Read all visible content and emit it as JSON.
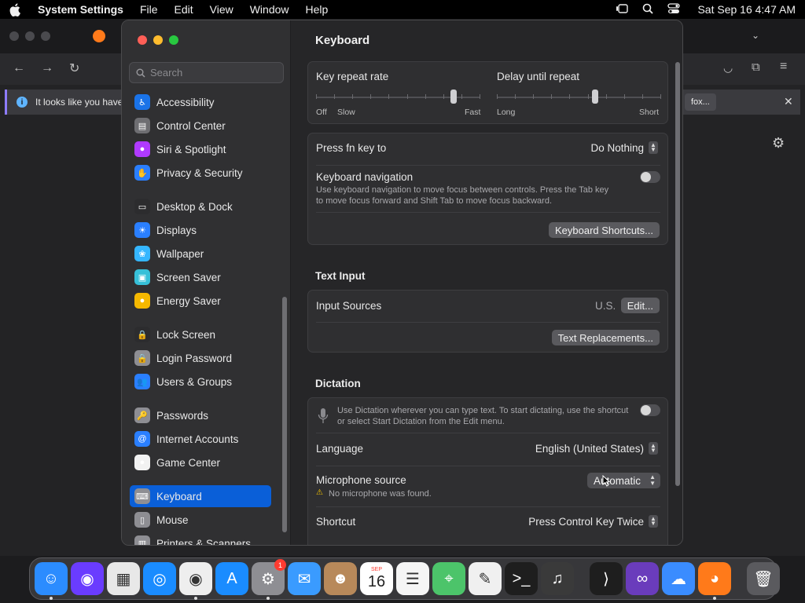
{
  "menubar": {
    "app_name": "System Settings",
    "items": [
      "File",
      "Edit",
      "View",
      "Window",
      "Help"
    ],
    "clock": "Sat Sep 16  4:47 AM"
  },
  "browser": {
    "notice_text": "It looks like you have",
    "notice_tail": "fox..."
  },
  "sidebar": {
    "search_placeholder": "Search",
    "items": [
      {
        "label": "Accessibility",
        "color": "#1a73e8",
        "glyph": "♿"
      },
      {
        "label": "Control Center",
        "color": "#6e6e72",
        "glyph": "▤"
      },
      {
        "label": "Siri & Spotlight",
        "color": "#b03aff",
        "glyph": "●"
      },
      {
        "label": "Privacy & Security",
        "color": "#2a7fff",
        "glyph": "✋"
      },
      {
        "label": "Desktop & Dock",
        "color": "#2c2c2e",
        "glyph": "▭"
      },
      {
        "label": "Displays",
        "color": "#2a7fff",
        "glyph": "☀"
      },
      {
        "label": "Wallpaper",
        "color": "#35b6ff",
        "glyph": "❀"
      },
      {
        "label": "Screen Saver",
        "color": "#37c0d8",
        "glyph": "▣"
      },
      {
        "label": "Energy Saver",
        "color": "#f5b800",
        "glyph": "●"
      },
      {
        "label": "Lock Screen",
        "color": "#2c2c2e",
        "glyph": "🔒"
      },
      {
        "label": "Login Password",
        "color": "#8e8e93",
        "glyph": "🔒"
      },
      {
        "label": "Users & Groups",
        "color": "#2a7fff",
        "glyph": "👥"
      },
      {
        "label": "Passwords",
        "color": "#8e8e93",
        "glyph": "🔑"
      },
      {
        "label": "Internet Accounts",
        "color": "#2a7fff",
        "glyph": "@"
      },
      {
        "label": "Game Center",
        "color": "#f2f2f2",
        "glyph": "●"
      },
      {
        "label": "Keyboard",
        "color": "#8e8e93",
        "glyph": "⌨"
      },
      {
        "label": "Mouse",
        "color": "#8e8e93",
        "glyph": "▯"
      },
      {
        "label": "Printers & Scanners",
        "color": "#8e8e93",
        "glyph": "▥"
      }
    ]
  },
  "content": {
    "title": "Keyboard",
    "key_repeat": {
      "label": "Key repeat rate",
      "min1": "Off",
      "min2": "Slow",
      "max": "Fast",
      "value": 0.84
    },
    "delay": {
      "label": "Delay until repeat",
      "min": "Long",
      "max": "Short",
      "value": 0.6
    },
    "fn_key": {
      "label": "Press fn key to",
      "value": "Do Nothing"
    },
    "keyboard_nav": {
      "label": "Keyboard navigation",
      "desc1": "Use keyboard navigation to move focus between controls. Press the Tab key",
      "desc2": "to move focus forward and Shift Tab to move focus backward.",
      "enabled": false
    },
    "shortcuts_button": "Keyboard Shortcuts...",
    "text_input": {
      "title": "Text Input",
      "input_sources": "Input Sources",
      "input_value": "U.S.",
      "edit_button": "Edit...",
      "replacements_button": "Text Replacements..."
    },
    "dictation": {
      "title": "Dictation",
      "desc1": "Use Dictation wherever you can type text. To start dictating, use the shortcut",
      "desc2": "or select Start Dictation from the Edit menu.",
      "enabled": false,
      "language_label": "Language",
      "language_value": "English (United States)",
      "mic_label": "Microphone source",
      "mic_warning": "No microphone was found.",
      "mic_value": "Automatic",
      "shortcut_label": "Shortcut",
      "shortcut_value": "Press Control Key Twice"
    }
  },
  "dock": {
    "settings_badge": "1",
    "calendar_month": "SEP",
    "calendar_day": "16",
    "apps": [
      {
        "name": "finder",
        "color": "#2b8cff",
        "glyph": "☺"
      },
      {
        "name": "siri",
        "color": "#6a3cff",
        "glyph": "◉"
      },
      {
        "name": "launchpad",
        "color": "#e8e8e8",
        "glyph": "▦"
      },
      {
        "name": "safari",
        "color": "#1a8cff",
        "glyph": "◎"
      },
      {
        "name": "chrome",
        "color": "#eeeeee",
        "glyph": "◉"
      },
      {
        "name": "app-store",
        "color": "#1a8cff",
        "glyph": "A"
      },
      {
        "name": "system-settings",
        "color": "#8e8e93",
        "glyph": "⚙"
      },
      {
        "name": "mail",
        "color": "#3a9bff",
        "glyph": "✉"
      },
      {
        "name": "contacts",
        "color": "#b8895a",
        "glyph": "☻"
      },
      {
        "name": "calendar",
        "color": "#ffffff",
        "glyph": ""
      },
      {
        "name": "reminders",
        "color": "#f5f5f5",
        "glyph": "☰"
      },
      {
        "name": "maps",
        "color": "#4cc46a",
        "glyph": "⌖"
      },
      {
        "name": "textedit",
        "color": "#f0f0f0",
        "glyph": "✎"
      },
      {
        "name": "terminal",
        "color": "#1e1e1e",
        "glyph": ">_"
      },
      {
        "name": "garageband",
        "color": "#3a3a3a",
        "glyph": "♫"
      },
      {
        "name": "vscode",
        "color": "#1e1e1e",
        "glyph": "⟩"
      },
      {
        "name": "visual-studio",
        "color": "#6a3cbc",
        "glyph": "∞"
      },
      {
        "name": "weather",
        "color": "#3a8cff",
        "glyph": "☁"
      },
      {
        "name": "firefox",
        "color": "#ff7a1a",
        "glyph": "◕"
      },
      {
        "name": "trash",
        "color": "#5a5a5e",
        "glyph": "🗑"
      }
    ]
  }
}
